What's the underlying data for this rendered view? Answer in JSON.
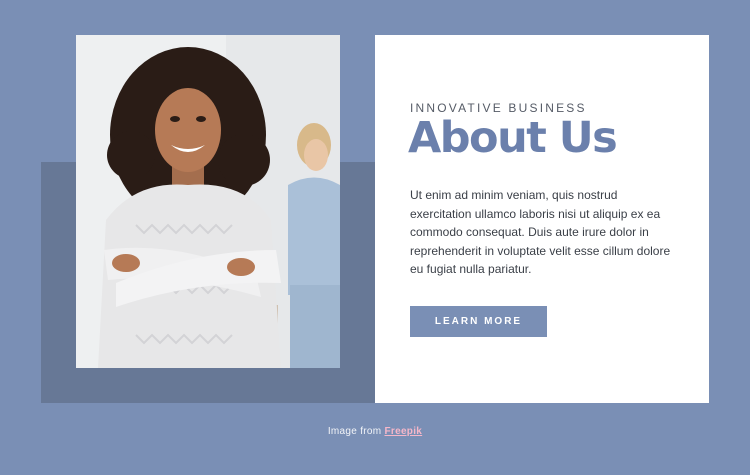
{
  "about": {
    "eyebrow": "INNOVATIVE BUSINESS",
    "title": "About Us",
    "body": "Ut enim ad minim veniam, quis nostrud exercitation ullamco laboris nisi ut aliquip ex ea commodo consequat. Duis aute irure dolor in reprehenderit in voluptate velit esse cillum dolore eu fugiat nulla pariatur.",
    "button_label": "LEARN MORE"
  },
  "credit": {
    "prefix": "Image from ",
    "link_text": "Freepik"
  },
  "image": {
    "subject": "smiling woman in white knit sweater with arms crossed, second woman in background"
  },
  "colors": {
    "background": "#7a8fb5",
    "dark_block": "#677896",
    "card": "#ffffff",
    "title": "#6b80ac",
    "button": "#7a8fb5",
    "link": "#f6b7c9"
  }
}
